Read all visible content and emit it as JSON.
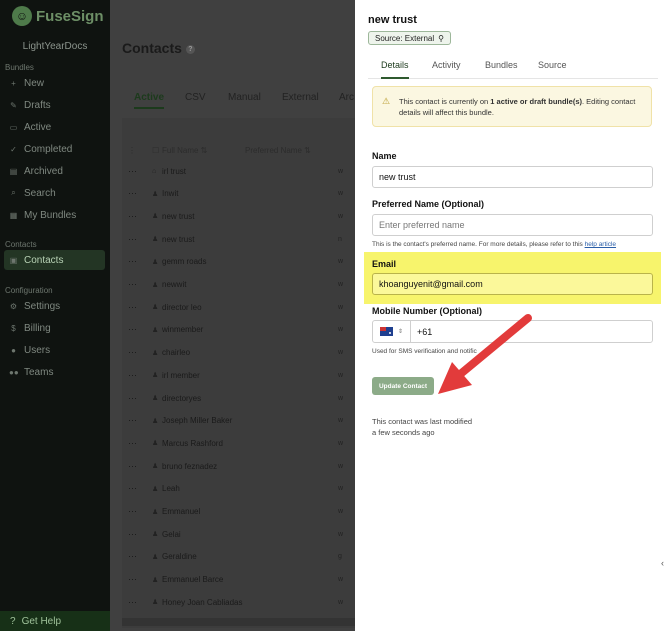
{
  "sidebar": {
    "brand": "FuseSign",
    "org": "LightYearDocs",
    "sections": {
      "bundles": "Bundles",
      "contacts": "Contacts",
      "configuration": "Configuration"
    },
    "items": [
      {
        "label": "New",
        "icon": "plus-icon"
      },
      {
        "label": "Drafts",
        "icon": "pencil-icon"
      },
      {
        "label": "Active",
        "icon": "folder-icon"
      },
      {
        "label": "Completed",
        "icon": "check-icon"
      },
      {
        "label": "Archived",
        "icon": "archive-icon"
      },
      {
        "label": "Search",
        "icon": "search-icon"
      },
      {
        "label": "My Bundles",
        "icon": "bundle-icon"
      },
      {
        "label": "Contacts",
        "icon": "contacts-icon"
      },
      {
        "label": "Settings",
        "icon": "gear-icon"
      },
      {
        "label": "Billing",
        "icon": "dollar-icon"
      },
      {
        "label": "Users",
        "icon": "user-icon"
      },
      {
        "label": "Teams",
        "icon": "team-icon"
      }
    ],
    "help": "Get Help"
  },
  "main": {
    "title": "Contacts",
    "tabs": [
      "Active",
      "CSV",
      "Manual",
      "External",
      "Arc"
    ],
    "columns": {
      "full_name": "Full Name",
      "preferred_name": "Preferred Name"
    },
    "rows": [
      "irl trust",
      "Inwit",
      "new trust",
      "new trust",
      "gemm roads",
      "newwit",
      "director leo",
      "winmember",
      "chairleo",
      "irl member",
      "directoryes",
      "Joseph Miller Baker",
      "Marcus Rashford",
      "bruno feznadez",
      "Leah",
      "Emmanuel",
      "Gelai",
      "Geraldine",
      "Emmanuel Barce",
      "Honey Joan Cabliadas"
    ],
    "row_tails": [
      "w",
      "w",
      "w",
      "n",
      "w",
      "w",
      "w",
      "w",
      "w",
      "w",
      "w",
      "w",
      "w",
      "w",
      "w",
      "w",
      "w",
      "g",
      "w",
      "w"
    ]
  },
  "panel": {
    "title": "new trust",
    "source_badge": "Source: External",
    "tabs": [
      "Details",
      "Activity",
      "Bundles",
      "Source"
    ],
    "alert": {
      "prefix": "This contact is currently on ",
      "bold": "1 active or draft bundle(s)",
      "suffix": ". Editing contact details will affect this bundle."
    },
    "name_label": "Name",
    "name_value": "new trust",
    "preferred_label": "Preferred Name (Optional)",
    "preferred_placeholder": "Enter preferred name",
    "preferred_hint": "This is the contact's preferred name. For more details, please refer to this ",
    "preferred_hint_link": "help article",
    "email_label": "Email",
    "email_value": "khoanguyenit@gmail.com",
    "mobile_label": "Mobile Number (Optional)",
    "dial_code": "+61",
    "mobile_hint": "Used for SMS verification and notific",
    "update_button": "Update Contact",
    "modified_line1": "This contact was last modified",
    "modified_line2": "a few seconds ago"
  },
  "colors": {
    "highlight": "#f7f46c",
    "arrow": "#e23b3b",
    "accent": "#2f5a2f"
  }
}
